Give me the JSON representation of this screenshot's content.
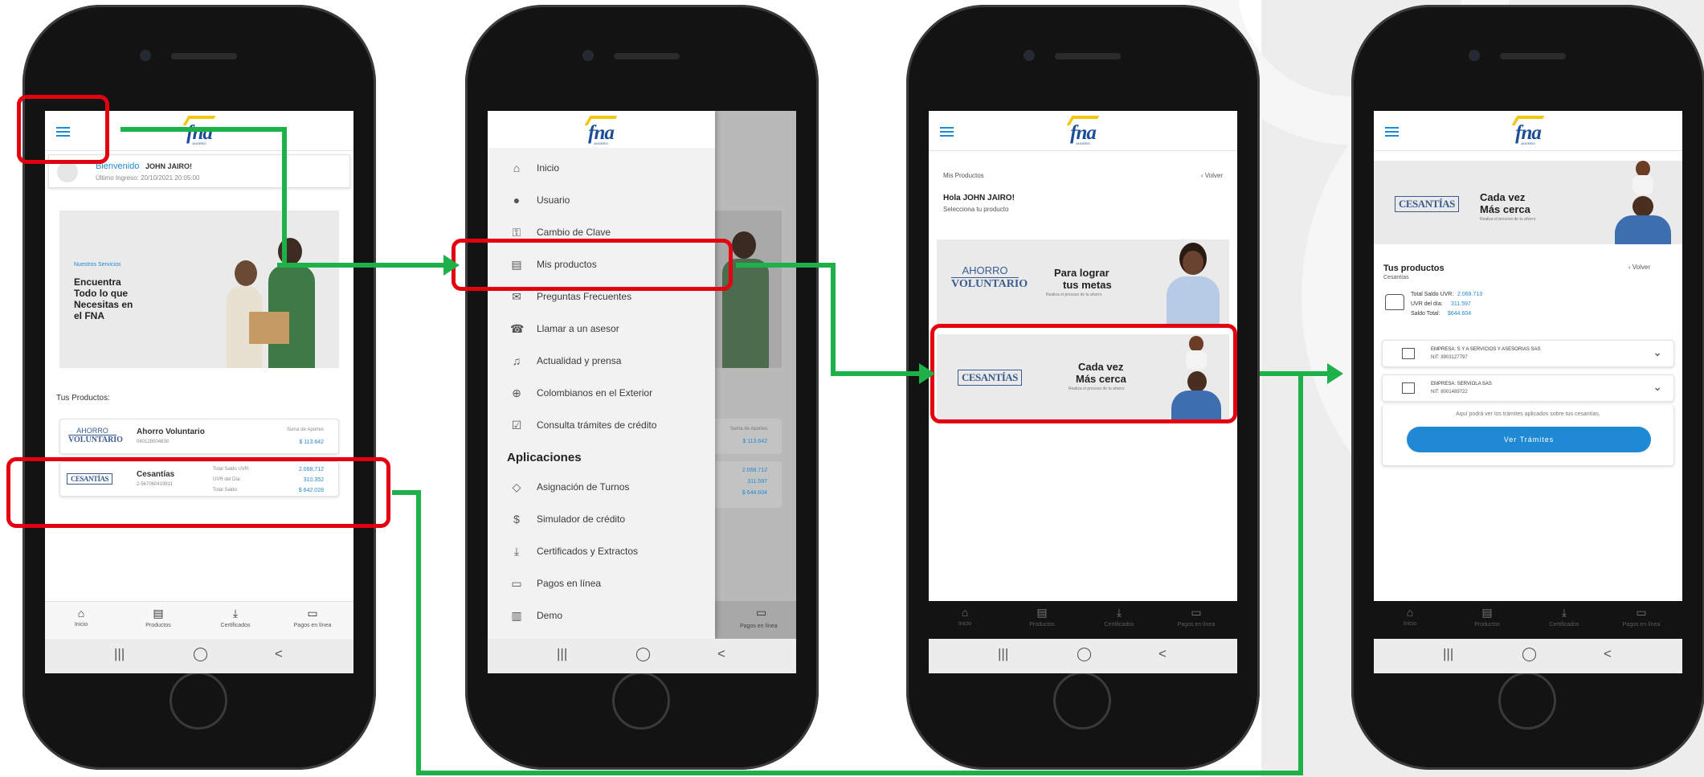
{
  "colors": {
    "accent": "#1f8ad3",
    "brand": "#1c4d96",
    "highlight": "#e3000f",
    "arrow": "#1eb14a",
    "logo_yellow": "#f3c612"
  },
  "common": {
    "logo_text": "fna",
    "logo_sub": "AHORRO",
    "sys": {
      "recents": "|||",
      "home": "◯",
      "back": "<"
    }
  },
  "bottom_nav": [
    {
      "label": "Inicio",
      "icon": "home-icon"
    },
    {
      "label": "Productos",
      "icon": "document-icon"
    },
    {
      "label": "Certificados",
      "icon": "download-icon"
    },
    {
      "label": "Pagos en línea",
      "icon": "card-icon"
    }
  ],
  "screen1": {
    "welcome_label": "Bienvenido",
    "user_name": "JOHN JAIRO!",
    "last_login": "Último Ingreso: 20/10/2021 20:05:00",
    "banner": {
      "tag": "Nuestros Servicios",
      "line1": "Encuentra",
      "line2": "Todo lo que",
      "line3": "Necesitas en",
      "line4": "el FNA"
    },
    "products_title": "Tus Productos:",
    "ahorro": {
      "logo_top": "AHORRO",
      "logo_bottom": "VOLUNTARIO",
      "name": "Ahorro Voluntario",
      "number": "040128004838",
      "sum_label": "Suma de Aportes",
      "sum_value": "$ 113.642"
    },
    "cesantias": {
      "logo": "CESANTÍAS",
      "name": "Cesantías",
      "number": "2-567060419811",
      "l1": "Total Saldo UVR:",
      "v1": "2.068,712",
      "l2": "UVR del Día:",
      "v2": "310.352",
      "l3": "Total Saldo:",
      "v3": "$ 642.028"
    }
  },
  "screen2": {
    "menu": [
      {
        "label": "Inicio",
        "icon": "home-icon"
      },
      {
        "label": "Usuario",
        "icon": "user-icon"
      },
      {
        "label": "Cambio de Clave",
        "icon": "lock-icon"
      },
      {
        "label": "Mis productos",
        "icon": "document-icon"
      },
      {
        "label": "Preguntas Frecuentes",
        "icon": "chat-icon"
      },
      {
        "label": "Llamar a un asesor",
        "icon": "phone-icon"
      },
      {
        "label": "Actualidad y prensa",
        "icon": "bell-icon"
      },
      {
        "label": "Colombianos en el Exterior",
        "icon": "globe-icon"
      },
      {
        "label": "Consulta trámites de crédito",
        "icon": "clipboard-icon"
      }
    ],
    "apps_title": "Aplicaciones",
    "apps": [
      {
        "label": "Asignación de Turnos",
        "icon": "ticket-icon"
      },
      {
        "label": "Simulador de crédito",
        "icon": "dollar-icon"
      },
      {
        "label": "Certificados y Extractos",
        "icon": "download-icon"
      },
      {
        "label": "Pagos en línea",
        "icon": "card-icon"
      },
      {
        "label": "Demo",
        "icon": "building-icon"
      }
    ],
    "bg_values": {
      "sum_label": "Suma de Aportes",
      "sum": "$ 113.642",
      "v1": "2.068.712",
      "v2": "311.597",
      "v3": "$ 644.604",
      "pay": "Pagos en línea"
    }
  },
  "screen3": {
    "breadcrumb": "Mis Productos",
    "back": "Volver",
    "greeting": "Hola JOHN JAIRO!",
    "subtitle": "Selecciona tu producto",
    "card1": {
      "logo_top": "AHORRO",
      "logo_bottom": "VOLUNTARIO",
      "line1": "Para lograr",
      "line2": "tus metas",
      "small": "Realiza el proceso de tu ahorro"
    },
    "card2": {
      "logo": "CESANTÍAS",
      "line1": "Cada vez",
      "line2": "Más cerca",
      "small": "Realiza el proceso de tu ahorro"
    }
  },
  "screen4": {
    "banner": {
      "logo": "CESANTÍAS",
      "line1": "Cada vez",
      "line2": "Más cerca",
      "small": "Realiza el proceso de tu ahorro"
    },
    "title": "Tus productos",
    "back": "Volver",
    "sub": "Cesantías",
    "l1": "Total Saldo UVR:",
    "v1": "2.068.713",
    "l2": "UVR del día:",
    "v2": "311.597",
    "l3": "Saldo Total:",
    "v3": "$644.604",
    "emp1": {
      "name": "EMPRESA: S Y A SERVICIOS Y ASESORIAS SAS",
      "nit": "NIT: 8903127797"
    },
    "emp2": {
      "name": "EMPRESA: SERVIOLA SAS",
      "nit": "NIT: 8001489722"
    },
    "info": "Aquí podrá ver los trámites aplicados sobre tus cesantías.",
    "button": "Ver Trámites"
  }
}
